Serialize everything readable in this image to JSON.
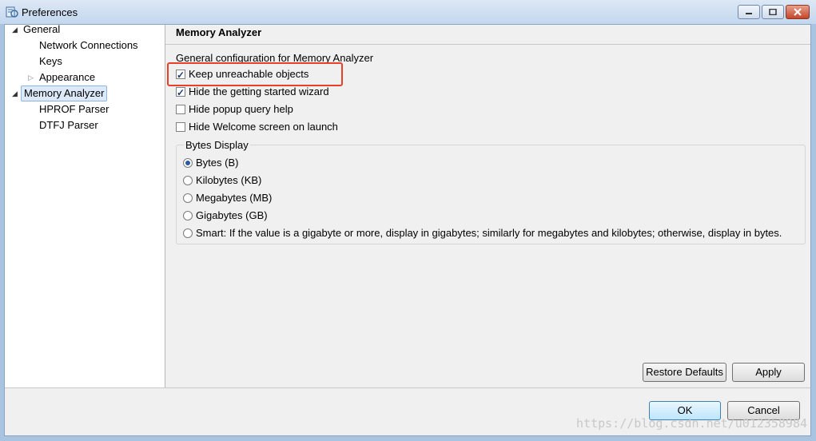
{
  "window": {
    "title": "Preferences"
  },
  "tree": {
    "items": [
      {
        "label": "General",
        "expanded": "expanded"
      },
      {
        "label": "Network Connections"
      },
      {
        "label": "Keys"
      },
      {
        "label": "Appearance",
        "expanded": "collapsed"
      },
      {
        "label": "Memory Analyzer",
        "expanded": "expanded",
        "selected": true
      },
      {
        "label": "HPROF Parser"
      },
      {
        "label": "DTFJ Parser"
      }
    ]
  },
  "page": {
    "title": "Memory Analyzer",
    "description": "General configuration for Memory Analyzer",
    "checkboxes": [
      {
        "label": "Keep unreachable objects",
        "checked": true
      },
      {
        "label": "Hide the getting started wizard",
        "checked": true
      },
      {
        "label": "Hide popup query help",
        "checked": false
      },
      {
        "label": "Hide Welcome screen on launch",
        "checked": false
      }
    ],
    "bytes_group": {
      "title": "Bytes Display",
      "options": [
        {
          "label": "Bytes (B)",
          "selected": true
        },
        {
          "label": "Kilobytes (KB)",
          "selected": false
        },
        {
          "label": "Megabytes (MB)",
          "selected": false
        },
        {
          "label": "Gigabytes (GB)",
          "selected": false
        },
        {
          "label": "Smart: If the value is a gigabyte or more, display in gigabytes; similarly for megabytes and kilobytes; otherwise, display in bytes.",
          "selected": false
        }
      ]
    },
    "restore_defaults_label": "Restore Defaults",
    "apply_label": "Apply"
  },
  "footer": {
    "ok_label": "OK",
    "cancel_label": "Cancel"
  },
  "watermark": "https://blog.csdn.net/u012358984",
  "colors": {
    "highlight": "#e8402a",
    "selection": "#dce9f8"
  }
}
